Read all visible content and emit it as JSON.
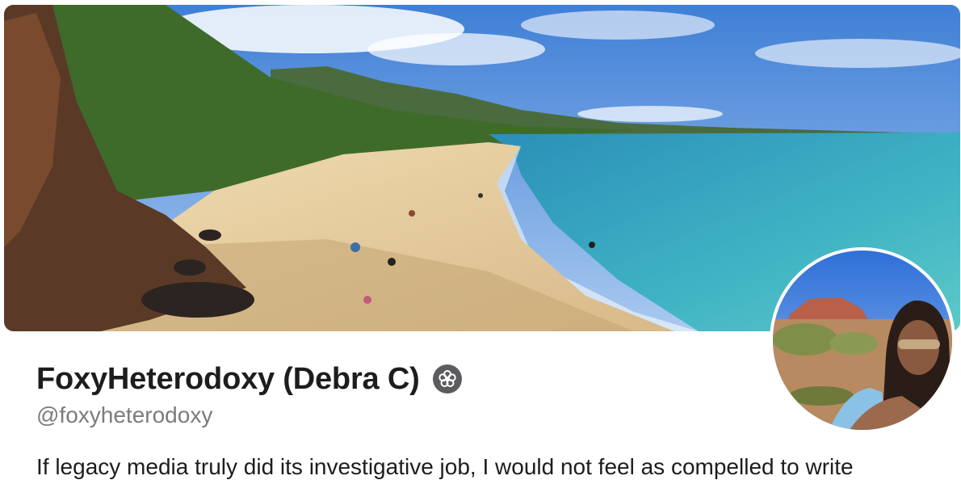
{
  "profile": {
    "display_name": "FoxyHeterodoxy (Debra C)",
    "handle": "@foxyheterodoxy",
    "bio": "If legacy media truly did its investigative job, I would not feel as compelled to write",
    "badge_icon": "flower-badge-icon"
  },
  "colors": {
    "text_primary": "#1d1d1f",
    "text_secondary": "#7b7b80",
    "badge": "#5c5c60"
  }
}
